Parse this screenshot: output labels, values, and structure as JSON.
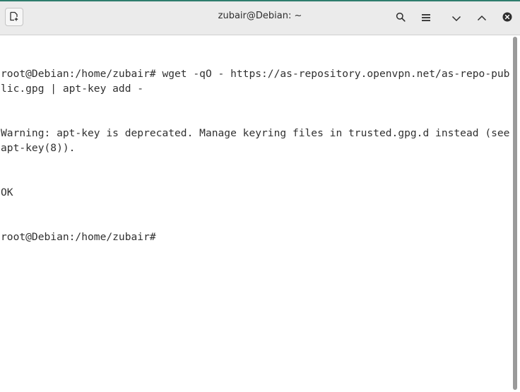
{
  "window": {
    "title": "zubair@Debian: ~"
  },
  "toolbar": {
    "new_tab_icon": "new-tab-icon",
    "search_icon": "search-icon",
    "menu_icon": "hamburger-menu-icon",
    "minimize_icon": "chevron-down-icon",
    "maximize_icon": "chevron-up-icon",
    "close_icon": "close-circle-icon"
  },
  "terminal": {
    "lines": [
      "root@Debian:/home/zubair# wget -qO - https://as-repository.openvpn.net/as-repo-public.gpg | apt-key add -",
      "Warning: apt-key is deprecated. Manage keyring files in trusted.gpg.d instead (see apt-key(8)).",
      "OK",
      "root@Debian:/home/zubair# "
    ]
  },
  "colors": {
    "titlebar_bg": "#ebebeb",
    "terminal_bg": "#ffffff",
    "terminal_fg": "#303030",
    "scrollbar_thumb": "#9a9a9a"
  }
}
